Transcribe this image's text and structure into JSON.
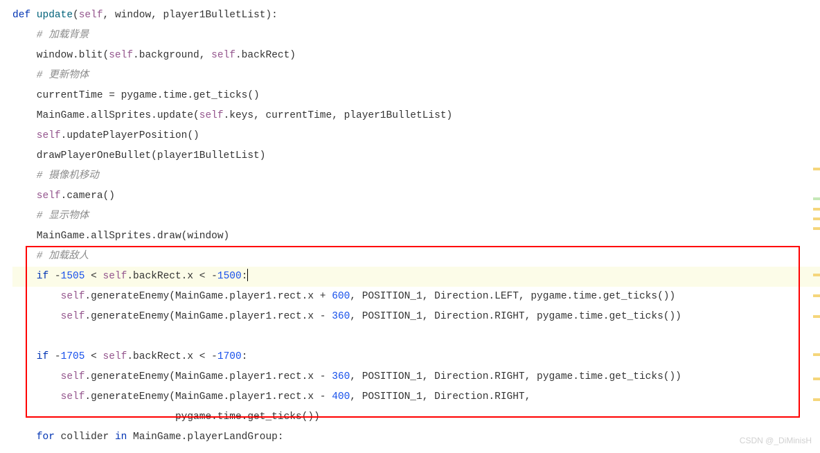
{
  "code": {
    "line1_def": "def",
    "line1_func": " update",
    "line1_open": "(",
    "line1_self": "self",
    "line1_rest": ", window, player1BulletList):",
    "line2_comment": "    # 加载背景",
    "line3_a": "    window.blit(",
    "line3_self": "self",
    "line3_b": ".background, ",
    "line3_self2": "self",
    "line3_c": ".backRect)",
    "line4_comment": "    # 更新物体",
    "line5": "    currentTime = pygame.time.get_ticks()",
    "line6_a": "    MainGame.allSprites.update(",
    "line6_self": "self",
    "line6_b": ".keys, currentTime, player1BulletList)",
    "line7_self": "    self",
    "line7_b": ".updatePlayerPosition()",
    "line8": "    drawPlayerOneBullet(player1BulletList)",
    "line9_comment": "    # 摄像机移动",
    "line10_self": "    self",
    "line10_b": ".camera()",
    "line11_comment": "    # 显示物体",
    "line12": "    MainGame.allSprites.draw(window)",
    "line13_comment": "    # 加载敌人",
    "line14_if": "    if",
    "line14_a": " -",
    "line14_n1": "1505",
    "line14_b": " < ",
    "line14_self": "self",
    "line14_c": ".backRect.x < -",
    "line14_n2": "1500",
    "line14_d": ":",
    "line15_self": "        self",
    "line15_a": ".generateEnemy(MainGame.player1.rect.x + ",
    "line15_n": "600",
    "line15_b": ", POSITION_1, Direction.LEFT, pygame.time.get_ticks())",
    "line16_self": "        self",
    "line16_a": ".generateEnemy(MainGame.player1.rect.x - ",
    "line16_n": "360",
    "line16_b": ", POSITION_1, Direction.RIGHT, pygame.time.get_ticks())",
    "line17": "",
    "line18_if": "    if",
    "line18_a": " -",
    "line18_n1": "1705",
    "line18_b": " < ",
    "line18_self": "self",
    "line18_c": ".backRect.x < -",
    "line18_n2": "1700",
    "line18_d": ":",
    "line19_self": "        self",
    "line19_a": ".generateEnemy(MainGame.player1.rect.x - ",
    "line19_n": "360",
    "line19_b": ", POSITION_1, Direction.RIGHT, pygame.time.get_ticks())",
    "line20_self": "        self",
    "line20_a": ".generateEnemy(MainGame.player1.rect.x - ",
    "line20_n": "400",
    "line20_b": ", POSITION_1, Direction.RIGHT,",
    "line21": "                           pygame.time.get_ticks())",
    "line22_for": "    for",
    "line22_a": " collider ",
    "line22_in": "in",
    "line22_b": " MainGame.playerLandGroup:"
  },
  "watermark": "CSDN @_DiMinisH"
}
